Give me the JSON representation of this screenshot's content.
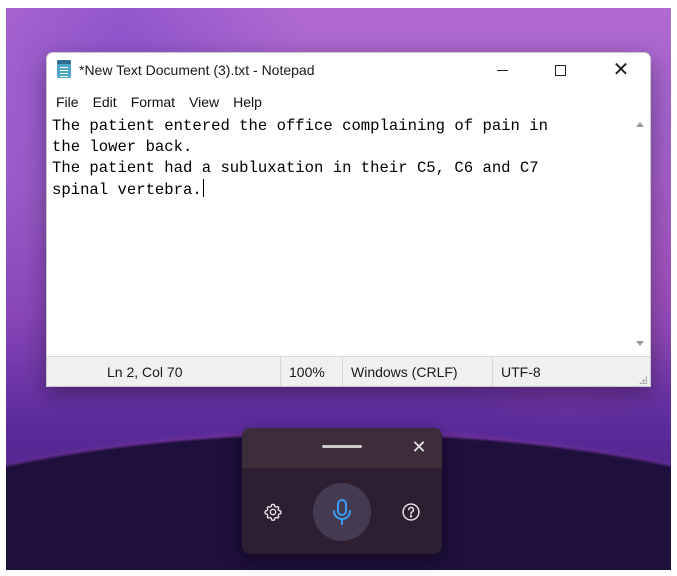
{
  "window": {
    "title": "*New Text Document (3).txt - Notepad",
    "icon": "notepad-icon"
  },
  "titlebar_buttons": {
    "minimize_icon": "minimize-icon",
    "maximize_icon": "maximize-icon",
    "close_icon": "close-icon",
    "close_glyph": "✕"
  },
  "menu": {
    "items": [
      "File",
      "Edit",
      "Format",
      "View",
      "Help"
    ]
  },
  "editor": {
    "content": "The patient entered the office complaining of pain in\nthe lower back.\nThe patient had a subluxation in their C5, C6 and C7\nspinal vertebra."
  },
  "statusbar": {
    "position": "Ln 2, Col 70",
    "zoom": "100%",
    "line_ending": "Windows (CRLF)",
    "encoding": "UTF-8"
  },
  "voice_typing": {
    "close_glyph": "✕",
    "settings_icon": "gear-icon",
    "mic_icon": "microphone-icon",
    "help_icon": "help-icon",
    "mic_color": "#3b9cf5"
  }
}
